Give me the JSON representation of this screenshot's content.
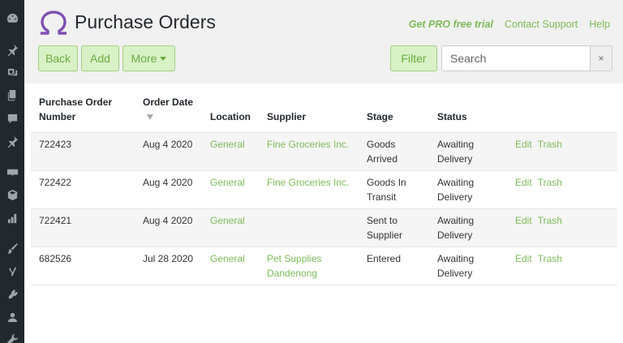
{
  "sidebar": {
    "icons": [
      "dashboard-icon",
      "pin-icon",
      "media-icon",
      "pages-icon",
      "comments-icon",
      "pin-icon",
      "woo-icon",
      "box-icon",
      "chart-icon",
      "brush-icon",
      "yoast-icon",
      "plugin-icon",
      "user-icon",
      "wrench-icon"
    ]
  },
  "header": {
    "title": "Purchase Orders",
    "pro_link": "Get PRO free trial",
    "support_link": "Contact Support",
    "help_link": "Help"
  },
  "toolbar": {
    "back_label": "Back",
    "add_label": "Add",
    "more_label": "More",
    "filter_label": "Filter",
    "search_placeholder": "Search",
    "clear_label": "×"
  },
  "table": {
    "headers": {
      "number_line1": "Purchase Order",
      "number_line2": "Number",
      "date_line1": "Order Date",
      "location": "Location",
      "supplier": "Supplier",
      "stage": "Stage",
      "status": "Status"
    },
    "rows": [
      {
        "number": "722423",
        "date": "Aug 4 2020",
        "location": "General",
        "supplier": "Fine Groceries Inc.",
        "stage1": "Goods",
        "stage2": "Arrived",
        "status1": "Awaiting",
        "status2": "Delivery",
        "edit": "Edit",
        "trash": "Trash"
      },
      {
        "number": "722422",
        "date": "Aug 4 2020",
        "location": "General",
        "supplier": "Fine Groceries Inc.",
        "stage1": "Goods In",
        "stage2": "Transit",
        "status1": "Awaiting",
        "status2": "Delivery",
        "edit": "Edit",
        "trash": "Trash"
      },
      {
        "number": "722421",
        "date": "Aug 4 2020",
        "location": "General",
        "supplier": "",
        "stage1": "Sent to",
        "stage2": "Supplier",
        "status1": "Awaiting",
        "status2": "Delivery",
        "edit": "Edit",
        "trash": "Trash"
      },
      {
        "number": "682526",
        "date": "Jul 28 2020",
        "location": "General",
        "supplier1": "Pet Supplies",
        "supplier2": "Dandenong",
        "stage1": "Entered",
        "stage2": "",
        "status1": "Awaiting",
        "status2": "Delivery",
        "edit": "Edit",
        "trash": "Trash"
      }
    ]
  },
  "colors": {
    "accent": "#7dbb58",
    "button_bg": "#d9f1c6",
    "sidebar_bg": "#23282d",
    "logo": "#7e4fb2"
  }
}
